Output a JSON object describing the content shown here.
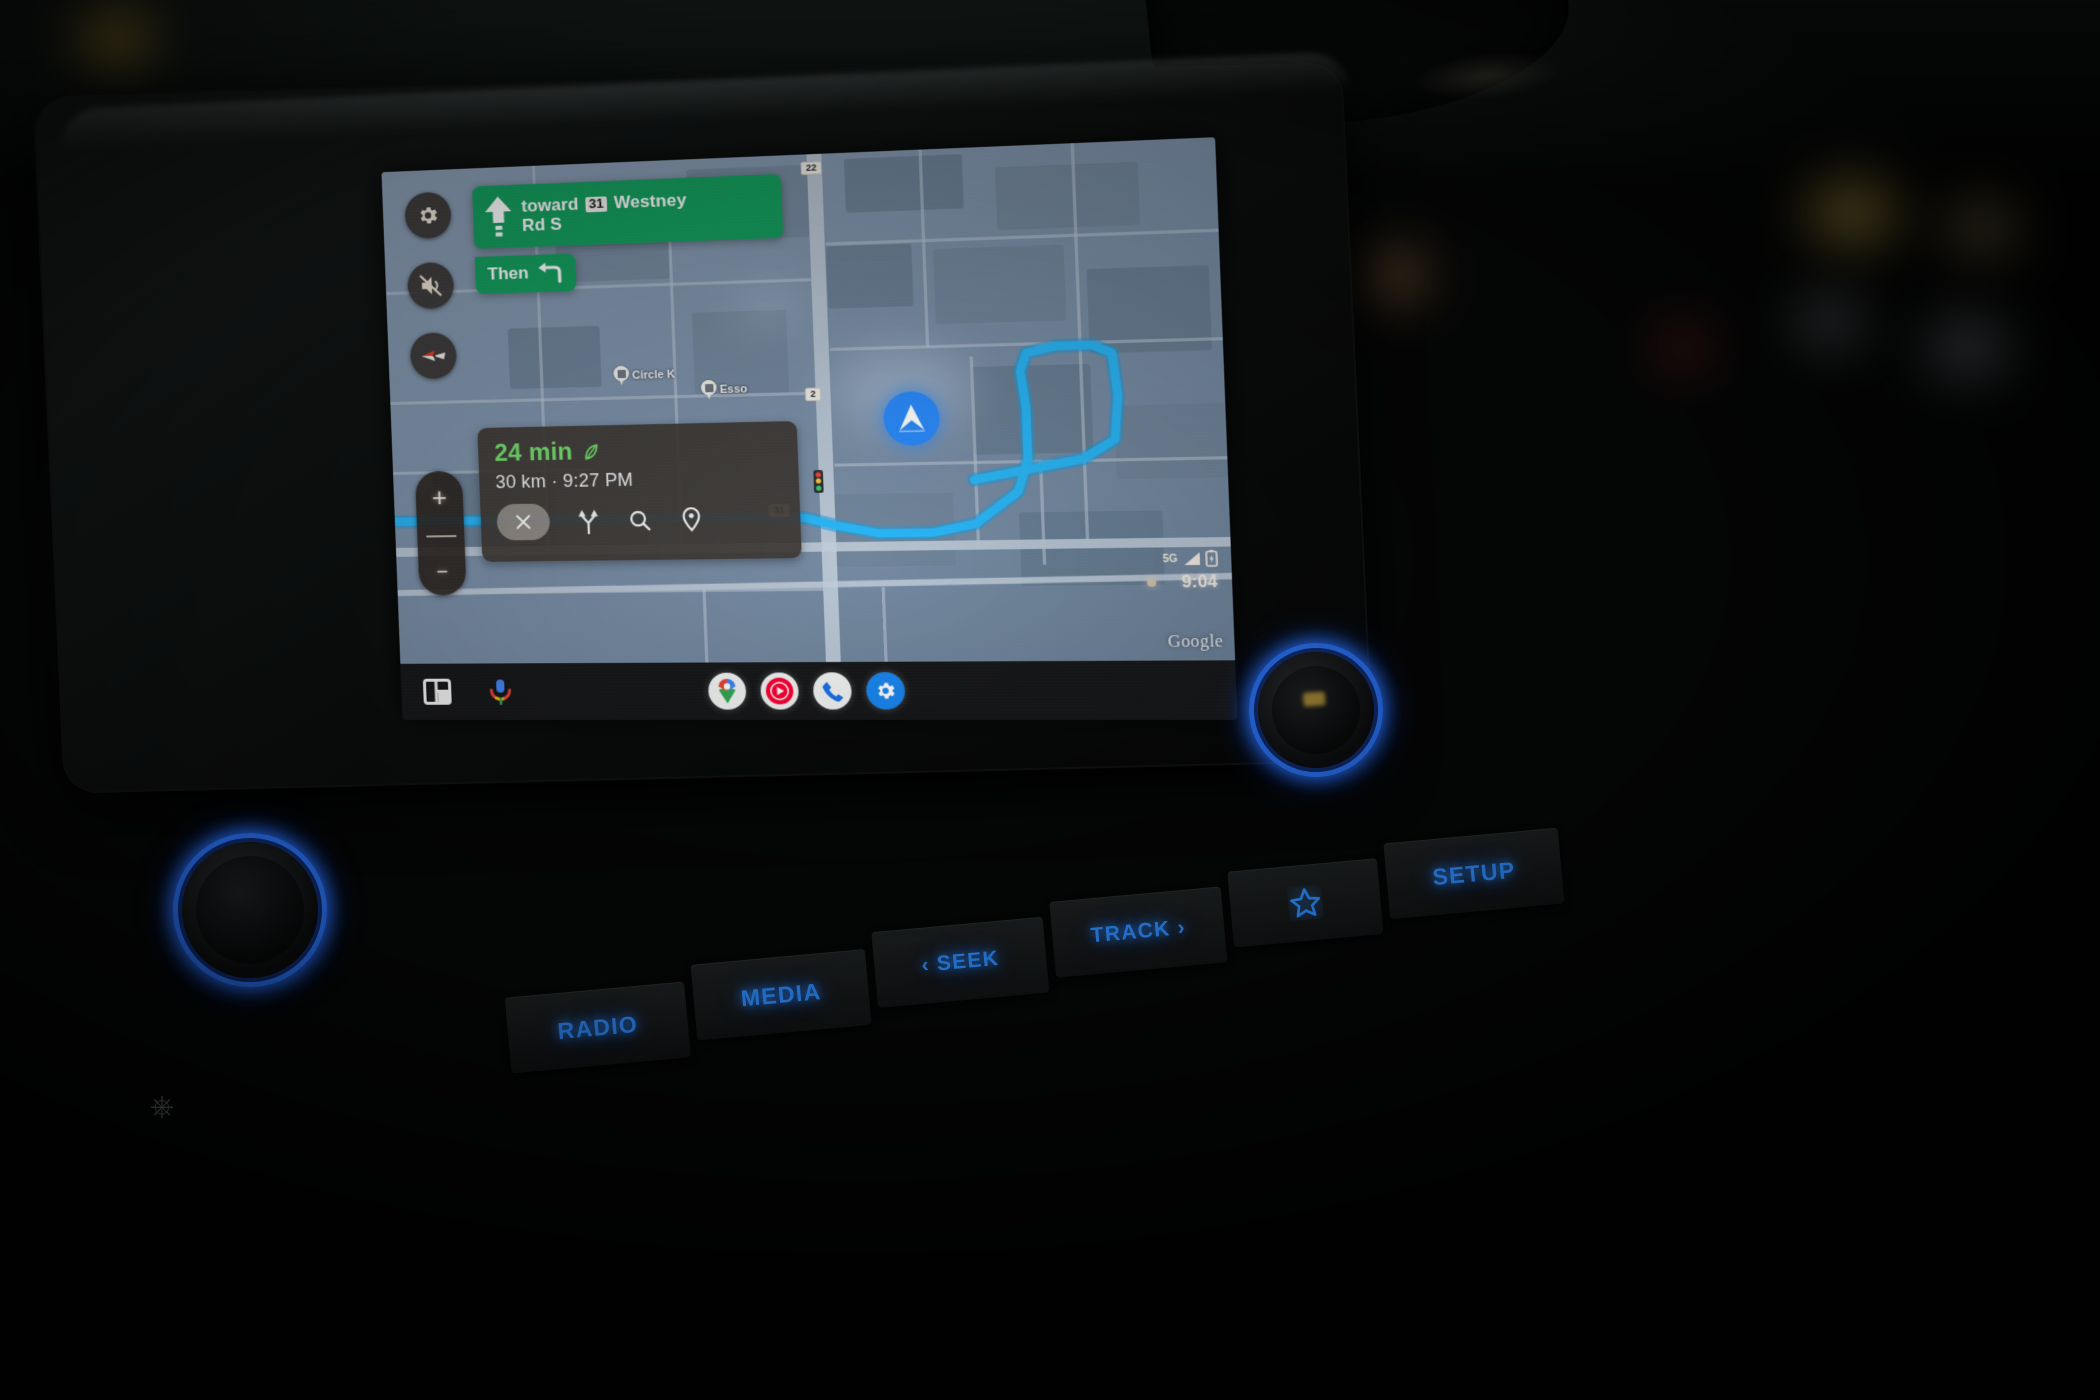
{
  "device": {
    "name": "car-infotainment-head-unit",
    "app": "Android Auto - Google Maps navigation"
  },
  "navigation": {
    "banner": {
      "maneuver_icon": "straight-arrow-icon",
      "text_prefix": "toward",
      "route_shield": "31",
      "text_suffix_line1": "Westney",
      "text_suffix_line2": "Rd S",
      "full_text": "toward 31 Westney Rd S",
      "background_color": "#15a05f"
    },
    "then": {
      "label": "Then",
      "maneuver_icon": "turn-left-arrow-icon"
    }
  },
  "eta_card": {
    "duration": "24 min",
    "eco_icon": "eco-leaf-icon",
    "distance_and_arrival": "30 km · 9:27 PM",
    "duration_color": "#74dd6d",
    "actions": [
      {
        "name": "close-navigation-button",
        "icon": "close-x-icon"
      },
      {
        "name": "alternate-routes-button",
        "icon": "route-fork-icon"
      },
      {
        "name": "search-along-route-button",
        "icon": "search-icon"
      },
      {
        "name": "destination-pin-button",
        "icon": "map-pin-icon"
      }
    ]
  },
  "map_controls": [
    {
      "name": "map-settings-button",
      "icon": "gear-icon"
    },
    {
      "name": "mute-voice-guidance-button",
      "icon": "volume-muted-icon"
    },
    {
      "name": "compass-button",
      "icon": "compass-icon"
    }
  ],
  "zoom_controls": {
    "zoom_in": "+",
    "zoom_out": "−"
  },
  "map": {
    "attribution": "Google",
    "road_shields": [
      "22",
      "31",
      "2"
    ],
    "pois": [
      {
        "label": "Circle K",
        "icon": "gas-station-pin-icon"
      },
      {
        "label": "Esso",
        "icon": "gas-station-pin-icon"
      }
    ],
    "route_color": "#2ab6f6",
    "vehicle_marker": "navigation-chevron-icon",
    "traffic_light_icon": "traffic-light-icon"
  },
  "status_bar": {
    "network": "5G",
    "signal_icon": "signal-bars-icon",
    "battery_icon": "battery-icon",
    "time": "9:04",
    "notification_dot": "notification-dot-icon"
  },
  "bottom_bar": {
    "left": [
      {
        "name": "split-screen-button",
        "icon": "dashboard-grid-icon"
      },
      {
        "name": "assistant-button",
        "icon": "assistant-mic-icon"
      }
    ],
    "apps": [
      {
        "name": "app-google-maps",
        "icon": "google-maps-pin-icon"
      },
      {
        "name": "app-youtube-music",
        "icon": "youtube-music-icon"
      },
      {
        "name": "app-phone",
        "icon": "phone-handset-icon"
      },
      {
        "name": "app-settings",
        "icon": "gear-icon"
      }
    ]
  },
  "hardware_buttons": [
    {
      "label": "RADIO",
      "name": "radio-button"
    },
    {
      "label": "MEDIA",
      "name": "media-button"
    },
    {
      "label": "‹ SEEK",
      "name": "seek-back-button"
    },
    {
      "label": "TRACK ›",
      "name": "track-forward-button"
    },
    {
      "label": "",
      "name": "favorites-star-button",
      "icon": "star-icon"
    },
    {
      "label": "SETUP",
      "name": "setup-button"
    }
  ],
  "knobs": [
    {
      "name": "power-volume-knob",
      "icon": "power-icon"
    },
    {
      "name": "tune-knob"
    }
  ],
  "colors": {
    "button_backlight": "#2f8dff",
    "nav_green": "#15a05f",
    "eta_green": "#74dd6d",
    "route_blue": "#2ab6f6"
  }
}
